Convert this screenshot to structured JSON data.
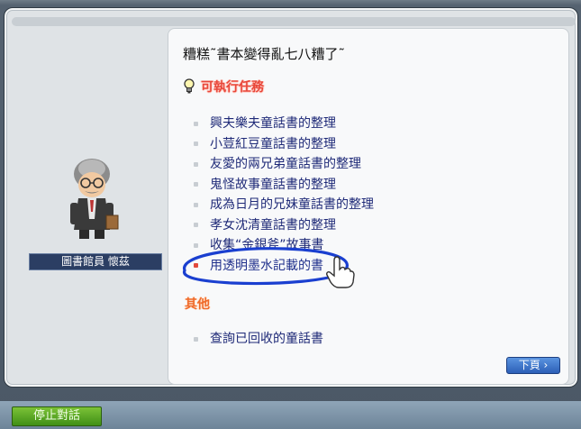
{
  "npc": {
    "name": "圖書館員 懷茲"
  },
  "dialog": {
    "title": "糟糕˜書本變得亂七八糟了˜",
    "section_available": "可執行任務",
    "quests": [
      "興夫樂夫童話書的整理",
      "小荳紅豆童話書的整理",
      "友愛的兩兄弟童話書的整理",
      "鬼怪故事童話書的整理",
      "成為日月的兄妹童話書的整理",
      "孝女沈清童話書的整理",
      "收集“金銀斧”故事書",
      "用透明墨水記載的書"
    ],
    "section_other": "其他",
    "other_items": [
      "查詢已回收的童話書"
    ],
    "next_button": "下頁 ›"
  },
  "bottom": {
    "stop_button": "停止對話"
  },
  "colors": {
    "quest_text": "#1f2a78",
    "section_red": "#e8473a",
    "other_orange": "#ef6a2a",
    "name_bar": "#2b3e63",
    "stop_green": "#5aa62a"
  },
  "icons": {
    "section": "lightbulb-icon",
    "cursor": "hand-cursor-icon"
  }
}
